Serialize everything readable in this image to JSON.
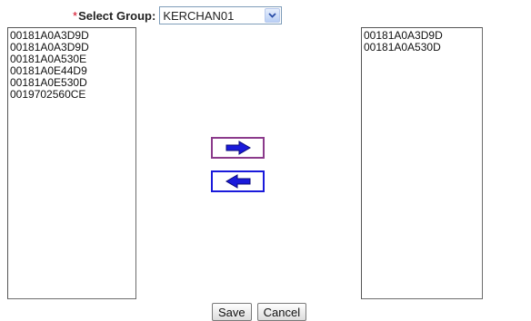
{
  "group_selector": {
    "required_mark": "*",
    "label": "Select Group:",
    "selected_value": "KERCHAN01"
  },
  "available_list": {
    "items": [
      "00181A0A3D9D",
      "00181A0A3D9D",
      "00181A0A530E",
      "00181A0E44D9",
      "00181A0E530D",
      "0019702560CE"
    ]
  },
  "selected_list": {
    "items": [
      "00181A0A3D9D",
      "00181A0A530D"
    ]
  },
  "transfer_buttons": {
    "move_right_icon": "right-arrow-icon",
    "move_left_icon": "left-arrow-icon",
    "arrow_color": "#1a1adb"
  },
  "actions": {
    "save_label": "Save",
    "cancel_label": "Cancel"
  }
}
